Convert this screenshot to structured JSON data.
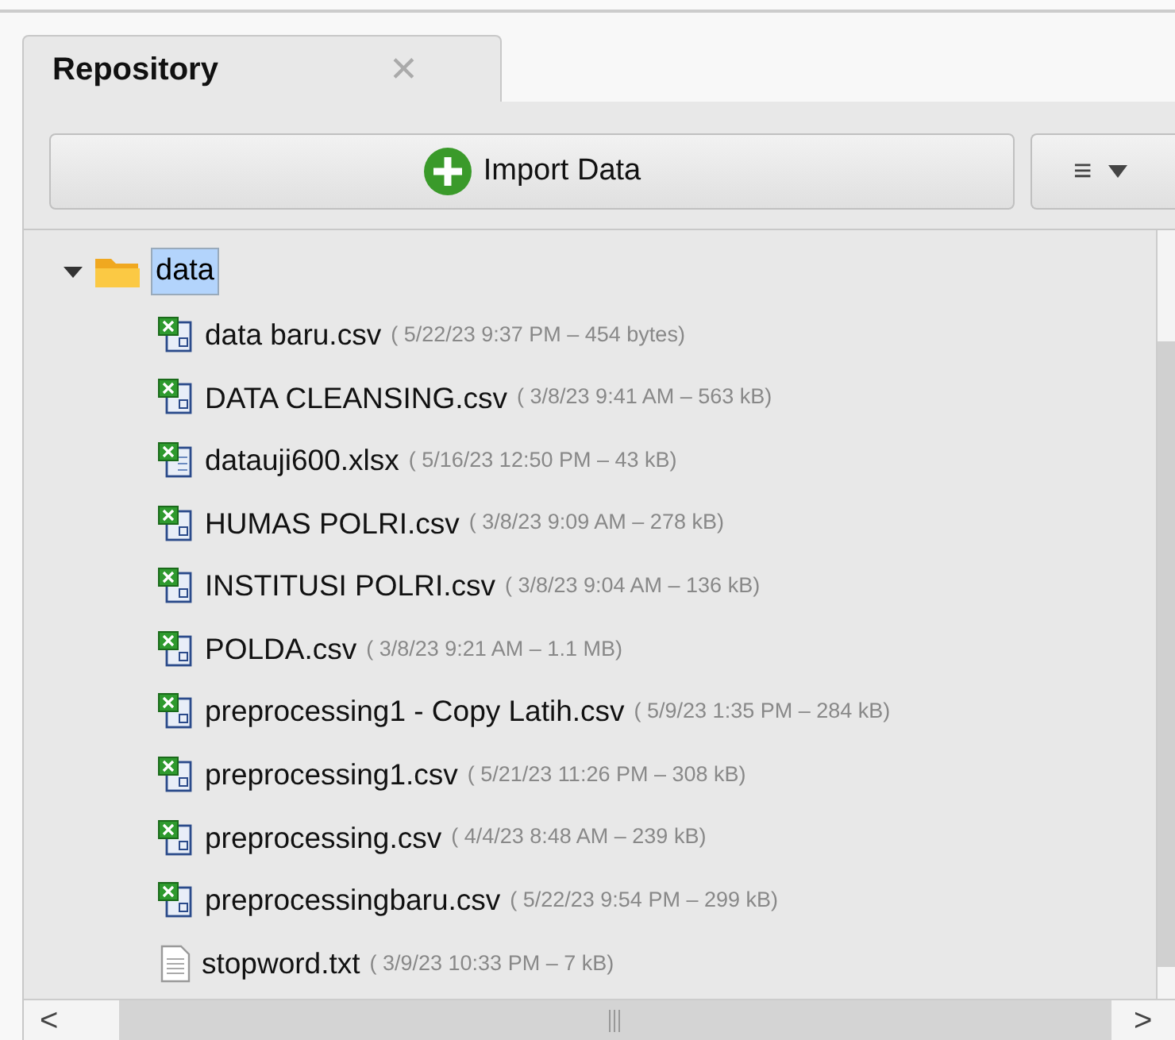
{
  "tab": {
    "label": "Repository",
    "close": "✕",
    "selected": true
  },
  "import_button": {
    "label": "Import Data"
  },
  "menu_button": {
    "label": "≡"
  },
  "tree": [
    {
      "name": "data",
      "kind": "folder",
      "expanded": true,
      "selected": true,
      "children": [
        {
          "name": "data baru.csv",
          "kind": "csv",
          "meta": "( 5/22/23 9:37 PM – 454 bytes)"
        },
        {
          "name": "DATA CLEANSING.csv",
          "kind": "csv",
          "meta": "( 3/8/23 9:41 AM – 563 kB)"
        },
        {
          "name": "datauji600.xlsx",
          "kind": "xlsx",
          "meta": "( 5/16/23 12:50 PM – 43 kB)"
        },
        {
          "name": "HUMAS POLRI.csv",
          "kind": "csv",
          "meta": "( 3/8/23 9:09 AM – 278 kB)"
        },
        {
          "name": "INSTITUSI POLRI.csv",
          "kind": "csv",
          "meta": "( 3/8/23 9:04 AM – 136 kB)"
        },
        {
          "name": "POLDA.csv",
          "kind": "csv",
          "meta": "( 3/8/23 9:21 AM – 1.1 MB)"
        },
        {
          "name": "preprocessing1 - Copy Latih.csv",
          "kind": "csv",
          "meta": "( 5/9/23 1:35 PM – 284 kB)"
        },
        {
          "name": "preprocessing1.csv",
          "kind": "csv",
          "meta": "( 5/21/23 11:26 PM – 308 kB)"
        },
        {
          "name": "preprocessing.csv",
          "kind": "csv",
          "meta": "( 4/4/23 8:48 AM – 239 kB)"
        },
        {
          "name": "preprocessingbaru.csv",
          "kind": "csv",
          "meta": "( 5/22/23 9:54 PM – 299 kB)"
        },
        {
          "name": "stopword.txt",
          "kind": "text",
          "meta": "( 3/9/23 10:33 PM – 7 kB)"
        }
      ]
    }
  ],
  "scroll_left": "<",
  "scroll_right": ">"
}
